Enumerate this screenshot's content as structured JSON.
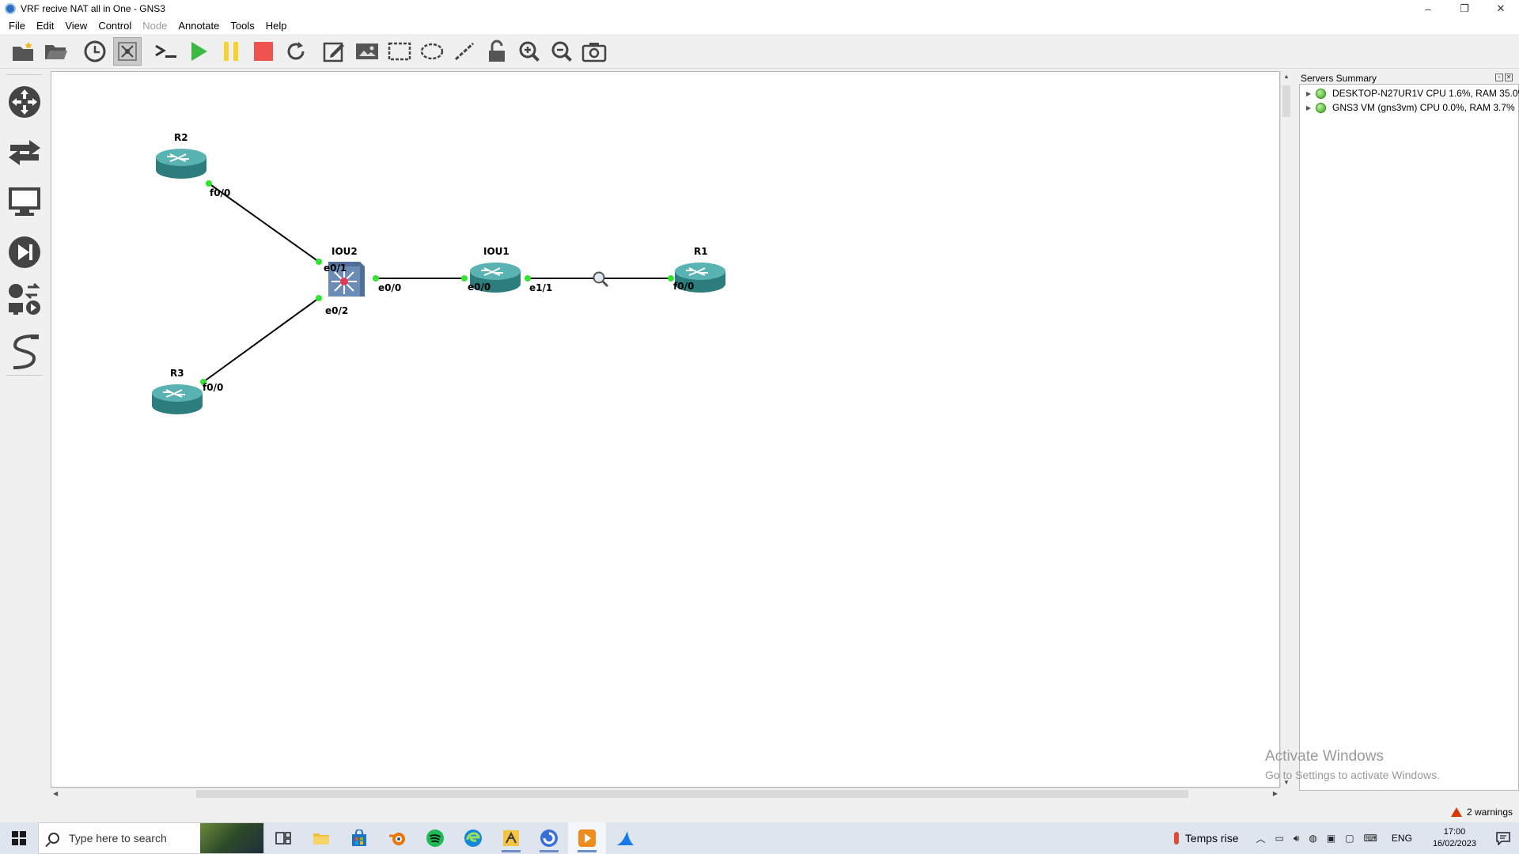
{
  "window": {
    "title": "VRF recive NAT all in One - GNS3",
    "controls": [
      "–",
      "❐",
      "✕"
    ]
  },
  "menu": [
    {
      "label": "File",
      "enabled": true
    },
    {
      "label": "Edit",
      "enabled": true
    },
    {
      "label": "View",
      "enabled": true
    },
    {
      "label": "Control",
      "enabled": true
    },
    {
      "label": "Node",
      "enabled": false
    },
    {
      "label": "Annotate",
      "enabled": true
    },
    {
      "label": "Tools",
      "enabled": true
    },
    {
      "label": "Help",
      "enabled": true
    }
  ],
  "toolbar": {
    "icons": [
      "new-project-icon",
      "open-project-icon",
      "snapshot-icon",
      "show-interface-labels-icon",
      "console-all-icon",
      "start-all-icon",
      "suspend-all-icon",
      "stop-all-icon",
      "reload-all-icon",
      "add-note-icon",
      "insert-image-icon",
      "draw-rectangle-icon",
      "draw-ellipse-icon",
      "draw-line-icon",
      "lock-icon",
      "zoom-in-icon",
      "zoom-out-icon",
      "screenshot-icon"
    ],
    "active": "show-interface-labels-icon"
  },
  "left_dock": [
    "browse-routers-icon",
    "browse-switches-icon",
    "browse-end-devices-icon",
    "browse-security-icon",
    "browse-all-devices-icon",
    "add-link-icon"
  ],
  "topology": {
    "nodes": {
      "R2": "R2",
      "R3": "R3",
      "IOU2": "IOU2",
      "IOU1": "IOU1",
      "R1": "R1"
    },
    "ports": {
      "r2_f00": "f0/0",
      "iou2_e01": "e0/1",
      "iou2_e00": "e0/0",
      "iou2_e02": "e0/2",
      "iou1_e00": "e0/0",
      "iou1_e11": "e1/1",
      "r1_f00": "f0/0",
      "r3_f00": "f0/0"
    },
    "colors": {
      "router": "#3f9c9c",
      "switch": "#5a7aa6",
      "port_up": "#2ee62e",
      "link": "#000000"
    }
  },
  "servers": {
    "title": "Servers Summary",
    "items": [
      "DESKTOP-N27UR1V CPU 1.6%, RAM 35.0%",
      "GNS3 VM (gns3vm) CPU 0.0%, RAM 3.7%"
    ]
  },
  "status": {
    "warnings": "2 warnings"
  },
  "watermark": {
    "line1": "Activate Windows",
    "line2": "Go to Settings to activate Windows."
  },
  "taskbar": {
    "search_placeholder": "Type here to search",
    "apps": [
      "task-view-icon",
      "file-explorer-icon",
      "microsoft-store-icon",
      "blender-icon",
      "spotify-icon",
      "edge-icon",
      "gns3-taskbar-icon",
      "browser-icon",
      "media-player-icon",
      "wireshark-icon"
    ],
    "weather": "Temps rise",
    "language": "ENG",
    "time": "17:00",
    "date": "16/02/2023"
  }
}
